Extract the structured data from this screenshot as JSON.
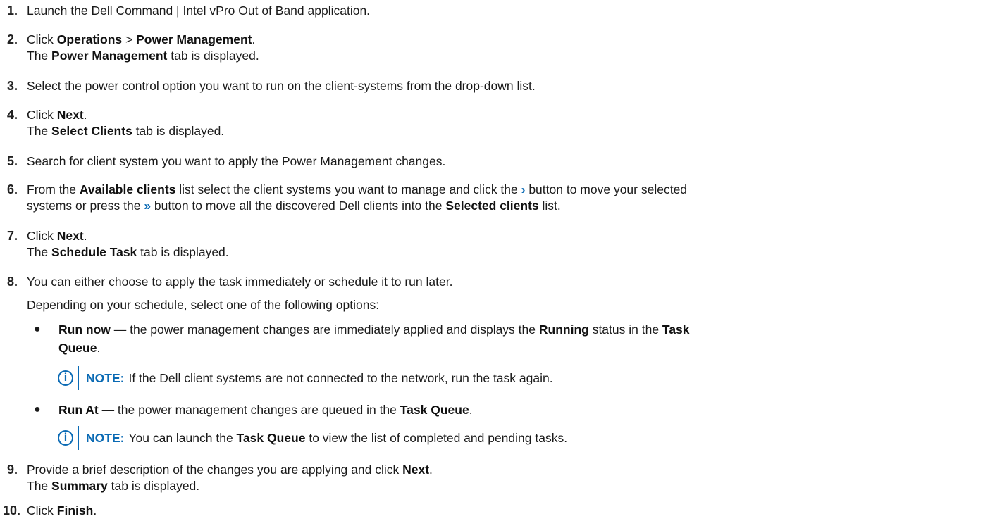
{
  "steps": [
    {
      "num": "1.",
      "text": "Launch the Dell Command | Intel vPro Out of Band application."
    },
    {
      "num": "2.",
      "a": "Click ",
      "b1": "Operations",
      "c": " > ",
      "b2": "Power Management",
      "d": ".",
      "sub_a": "The ",
      "sub_b": "Power Management",
      "sub_c": " tab is displayed."
    },
    {
      "num": "3.",
      "text": "Select the power control option you want to run on the client-systems from the drop-down list."
    },
    {
      "num": "4.",
      "a": "Click ",
      "b1": "Next",
      "d": ".",
      "sub_a": "The ",
      "sub_b": "Select Clients",
      "sub_c": " tab is displayed."
    },
    {
      "num": "5.",
      "text": "Search for client system you want to apply the Power Management changes."
    },
    {
      "num": "6.",
      "a": "From the ",
      "b1": "Available clients",
      "c": " list select the client systems you want to manage and click the ",
      "chev1": "›",
      "d": " button to move your selected",
      "line2_a": "systems or press the ",
      "chev2": "»",
      "line2_b": " button to move all the discovered Dell clients into the ",
      "line2_bold": "Selected clients",
      "line2_c": " list."
    },
    {
      "num": "7.",
      "a": "Click ",
      "b1": "Next",
      "d": ".",
      "sub_a": "The ",
      "sub_b": "Schedule Task",
      "sub_c": " tab is displayed."
    },
    {
      "num": "8.",
      "text": "You can either choose to apply the task immediately or schedule it to run later.",
      "para": "Depending on your schedule, select one of the following options:"
    },
    {
      "num": "9.",
      "a": "Provide a brief description of the changes you are applying and click ",
      "b1": "Next",
      "d": ".",
      "sub_a": "The ",
      "sub_b": "Summary",
      "sub_c": " tab is displayed."
    },
    {
      "num": "10.",
      "a": "Click ",
      "b1": "Finish",
      "d": "."
    }
  ],
  "bullets": [
    {
      "dot": "●",
      "bold": "Run now",
      "text1": " — the power management changes are immediately applied and displays the ",
      "bold2": "Running",
      "text2": " status in the ",
      "bold3": "Task",
      "line2_bold": "Queue",
      "line2_end": "."
    },
    {
      "dot": "●",
      "bold": "Run At",
      "text1": " — the power management changes are queued in the ",
      "bold2": "Task Queue",
      "end": "."
    }
  ],
  "notes": [
    {
      "icon": "i",
      "label": "NOTE:",
      "text": "If the Dell client systems are not connected to the network, run the task again."
    },
    {
      "icon": "i",
      "label": "NOTE:",
      "a": "You can launch the ",
      "bold": "Task Queue",
      "b": " to view the list of completed and pending tasks."
    }
  ]
}
